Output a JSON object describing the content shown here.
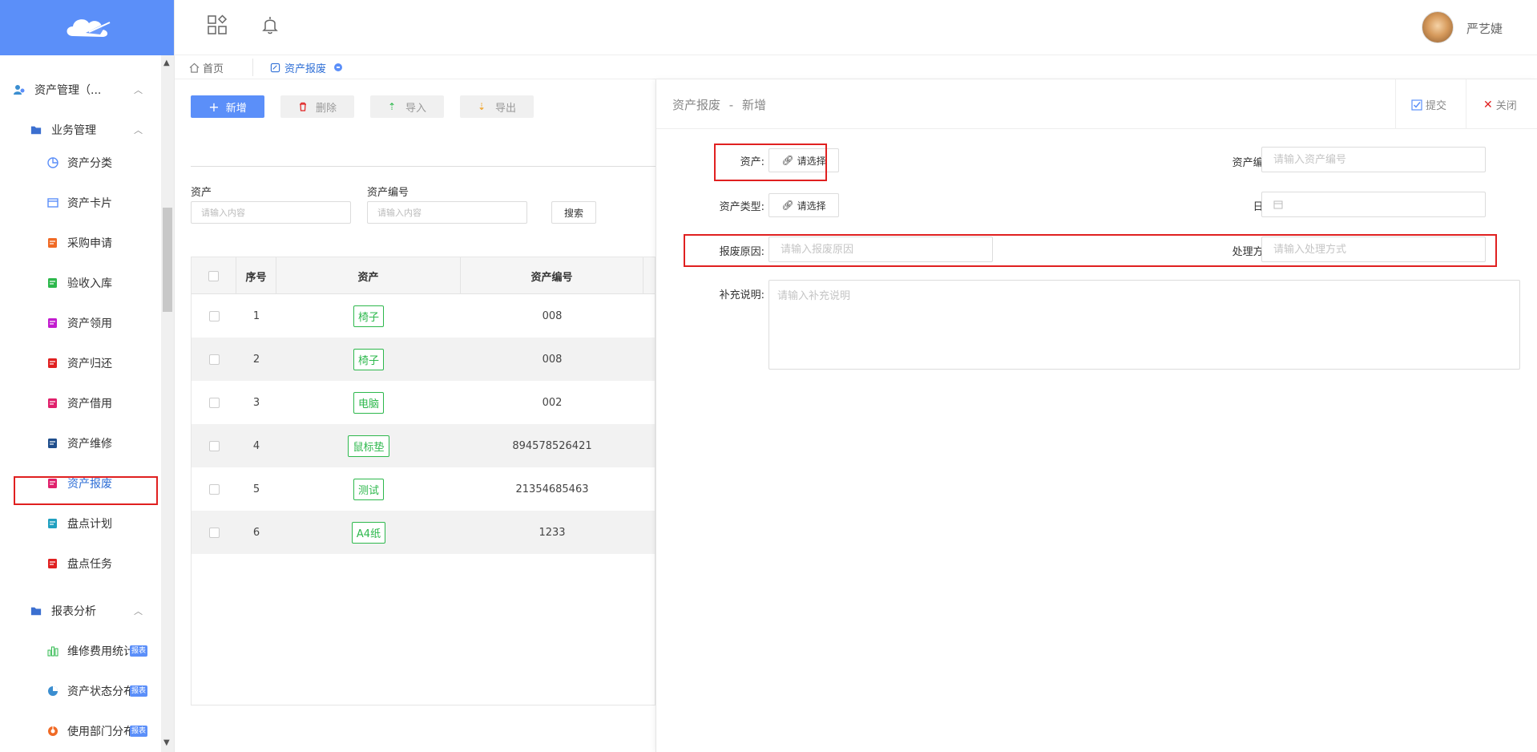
{
  "header": {
    "username": "严艺婕"
  },
  "sidebar": {
    "group_asset_mgmt": "资产管理（...",
    "group_business": "业务管理",
    "items": [
      {
        "label": "资产分类",
        "icon": "pie-icon",
        "color": "#5b8ff9"
      },
      {
        "label": "资产卡片",
        "icon": "card-icon",
        "color": "#5b8ff9"
      },
      {
        "label": "采购申请",
        "icon": "purchase-icon",
        "color": "#f06a25"
      },
      {
        "label": "验收入库",
        "icon": "check-in-icon",
        "color": "#2db84c"
      },
      {
        "label": "资产领用",
        "icon": "receive-icon",
        "color": "#c21ccf"
      },
      {
        "label": "资产归还",
        "icon": "return-icon",
        "color": "#e02020"
      },
      {
        "label": "资产借用",
        "icon": "borrow-icon",
        "color": "#e0206b"
      },
      {
        "label": "资产维修",
        "icon": "repair-icon",
        "color": "#1f4e8c"
      },
      {
        "label": "资产报废",
        "icon": "scrap-icon",
        "color": "#e0206b"
      },
      {
        "label": "盘点计划",
        "icon": "plan-icon",
        "color": "#20a0c0"
      },
      {
        "label": "盘点任务",
        "icon": "task-icon",
        "color": "#e02020"
      }
    ],
    "group_report": "报表分析",
    "report_items": [
      {
        "label": "维修费用统计",
        "badge": "报表",
        "icon": "bar-chart-icon",
        "color": "#2db84c"
      },
      {
        "label": "资产状态分布",
        "badge": "报表",
        "icon": "pie-chart-icon",
        "color": "#3b8ed0"
      },
      {
        "label": "使用部门分布",
        "badge": "报表",
        "icon": "donut-chart-icon",
        "color": "#f06a25"
      }
    ]
  },
  "tabs": {
    "home": "首页",
    "current": "资产报废"
  },
  "toolbar": {
    "add": "新增",
    "delete": "删除",
    "import": "导入",
    "export": "导出"
  },
  "filters": {
    "asset_label": "资产",
    "asset_placeholder": "请输入内容",
    "code_label": "资产编号",
    "code_placeholder": "请输入内容",
    "search": "搜索"
  },
  "table": {
    "columns": [
      "序号",
      "资产",
      "资产编号"
    ],
    "rows": [
      {
        "no": "1",
        "asset": "椅子",
        "code": "008"
      },
      {
        "no": "2",
        "asset": "椅子",
        "code": "008"
      },
      {
        "no": "3",
        "asset": "电脑",
        "code": "002"
      },
      {
        "no": "4",
        "asset": "鼠标垫",
        "code": "894578526421"
      },
      {
        "no": "5",
        "asset": "测试",
        "code": "21354685463"
      },
      {
        "no": "6",
        "asset": "A4纸",
        "code": "1233"
      }
    ]
  },
  "form": {
    "title": "资产报废",
    "title_sep": "-",
    "mode": "新增",
    "submit": "提交",
    "close": "关闭",
    "asset_label": "资产:",
    "choose": "请选择",
    "asset_code_label": "资产编号:",
    "asset_code_placeholder": "请输入资产编号",
    "asset_type_label": "资产类型:",
    "date_label": "日期:",
    "reason_label": "报废原因:",
    "reason_placeholder": "请输入报废原因",
    "method_label": "处理方式:",
    "method_placeholder": "请输入处理方式",
    "note_label": "补充说明:",
    "note_placeholder": "请输入补充说明"
  },
  "colors": {
    "primary": "#5b8ff9",
    "tag_green": "#2db84c",
    "highlight_red": "#e02020"
  }
}
